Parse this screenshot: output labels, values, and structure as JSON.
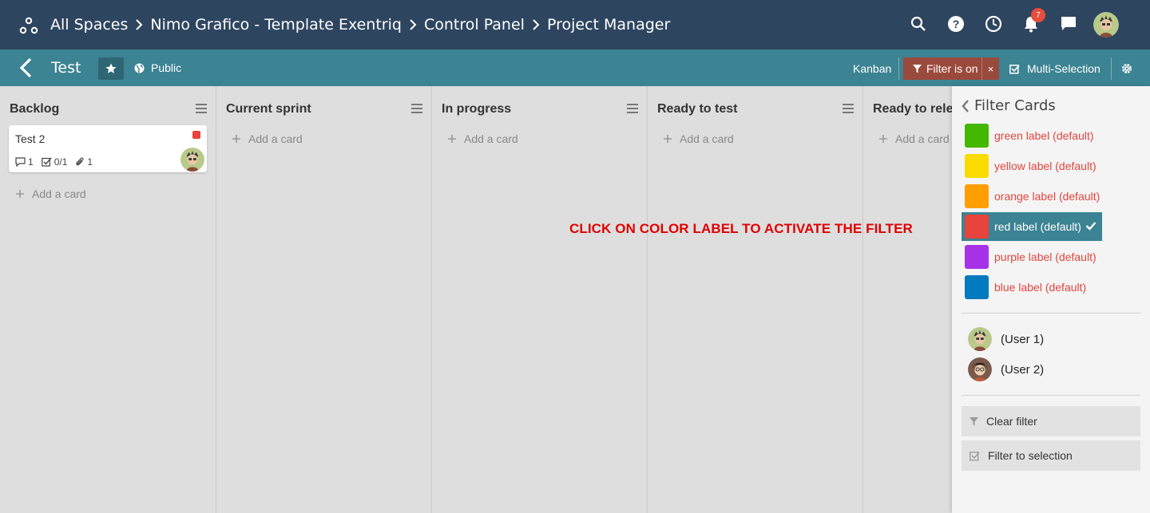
{
  "header": {
    "breadcrumbs": [
      "All Spaces",
      "Nimo Grafico - Template Exentriq",
      "Control Panel",
      "Project Manager"
    ],
    "notifications_count": "7",
    "icons": [
      "spaces-icon",
      "search-icon",
      "help-icon",
      "clock-icon",
      "bell-icon",
      "chat-icon",
      "avatar"
    ]
  },
  "board": {
    "title": "Test",
    "visibility": "Public",
    "view": "Kanban",
    "filter_status": "Filter is on",
    "filter_clear": "×",
    "multi_selection": "Multi-Selection"
  },
  "columns": [
    {
      "title": "Backlog",
      "add_label": "Add a card"
    },
    {
      "title": "Current sprint",
      "add_label": "Add a card"
    },
    {
      "title": "In progress",
      "add_label": "Add a card"
    },
    {
      "title": "Ready to test",
      "add_label": "Add a card"
    },
    {
      "title": "Ready to rele",
      "add_label": "Add a card"
    }
  ],
  "card": {
    "title": "Test 2",
    "label_color": "#e8433c",
    "comments": "1",
    "checklist": "0/1",
    "attachments": "1"
  },
  "instruction": "CLICK ON COLOR LABEL TO ACTIVATE THE FILTER",
  "filter_panel": {
    "title": "Filter Cards",
    "labels": [
      {
        "name": "green label (default)",
        "color": "#44b700",
        "active": false
      },
      {
        "name": "yellow label (default)",
        "color": "#fadc00",
        "active": false
      },
      {
        "name": "orange label (default)",
        "color": "#ff9e00",
        "active": false
      },
      {
        "name": "red label (default)",
        "color": "#e8433c",
        "active": true
      },
      {
        "name": "purple label (default)",
        "color": "#a632e8",
        "active": false
      },
      {
        "name": "blue label (default)",
        "color": "#0079bf",
        "active": false
      }
    ],
    "users": [
      "(User 1)",
      "(User 2)"
    ],
    "clear_filter": "Clear filter",
    "filter_to_selection": "Filter to selection"
  },
  "colors": {
    "topbar": "#2e4560",
    "subbar": "#3c8393",
    "filter_on_bg": "#9a4a3c",
    "instruction_text": "#e00000"
  }
}
